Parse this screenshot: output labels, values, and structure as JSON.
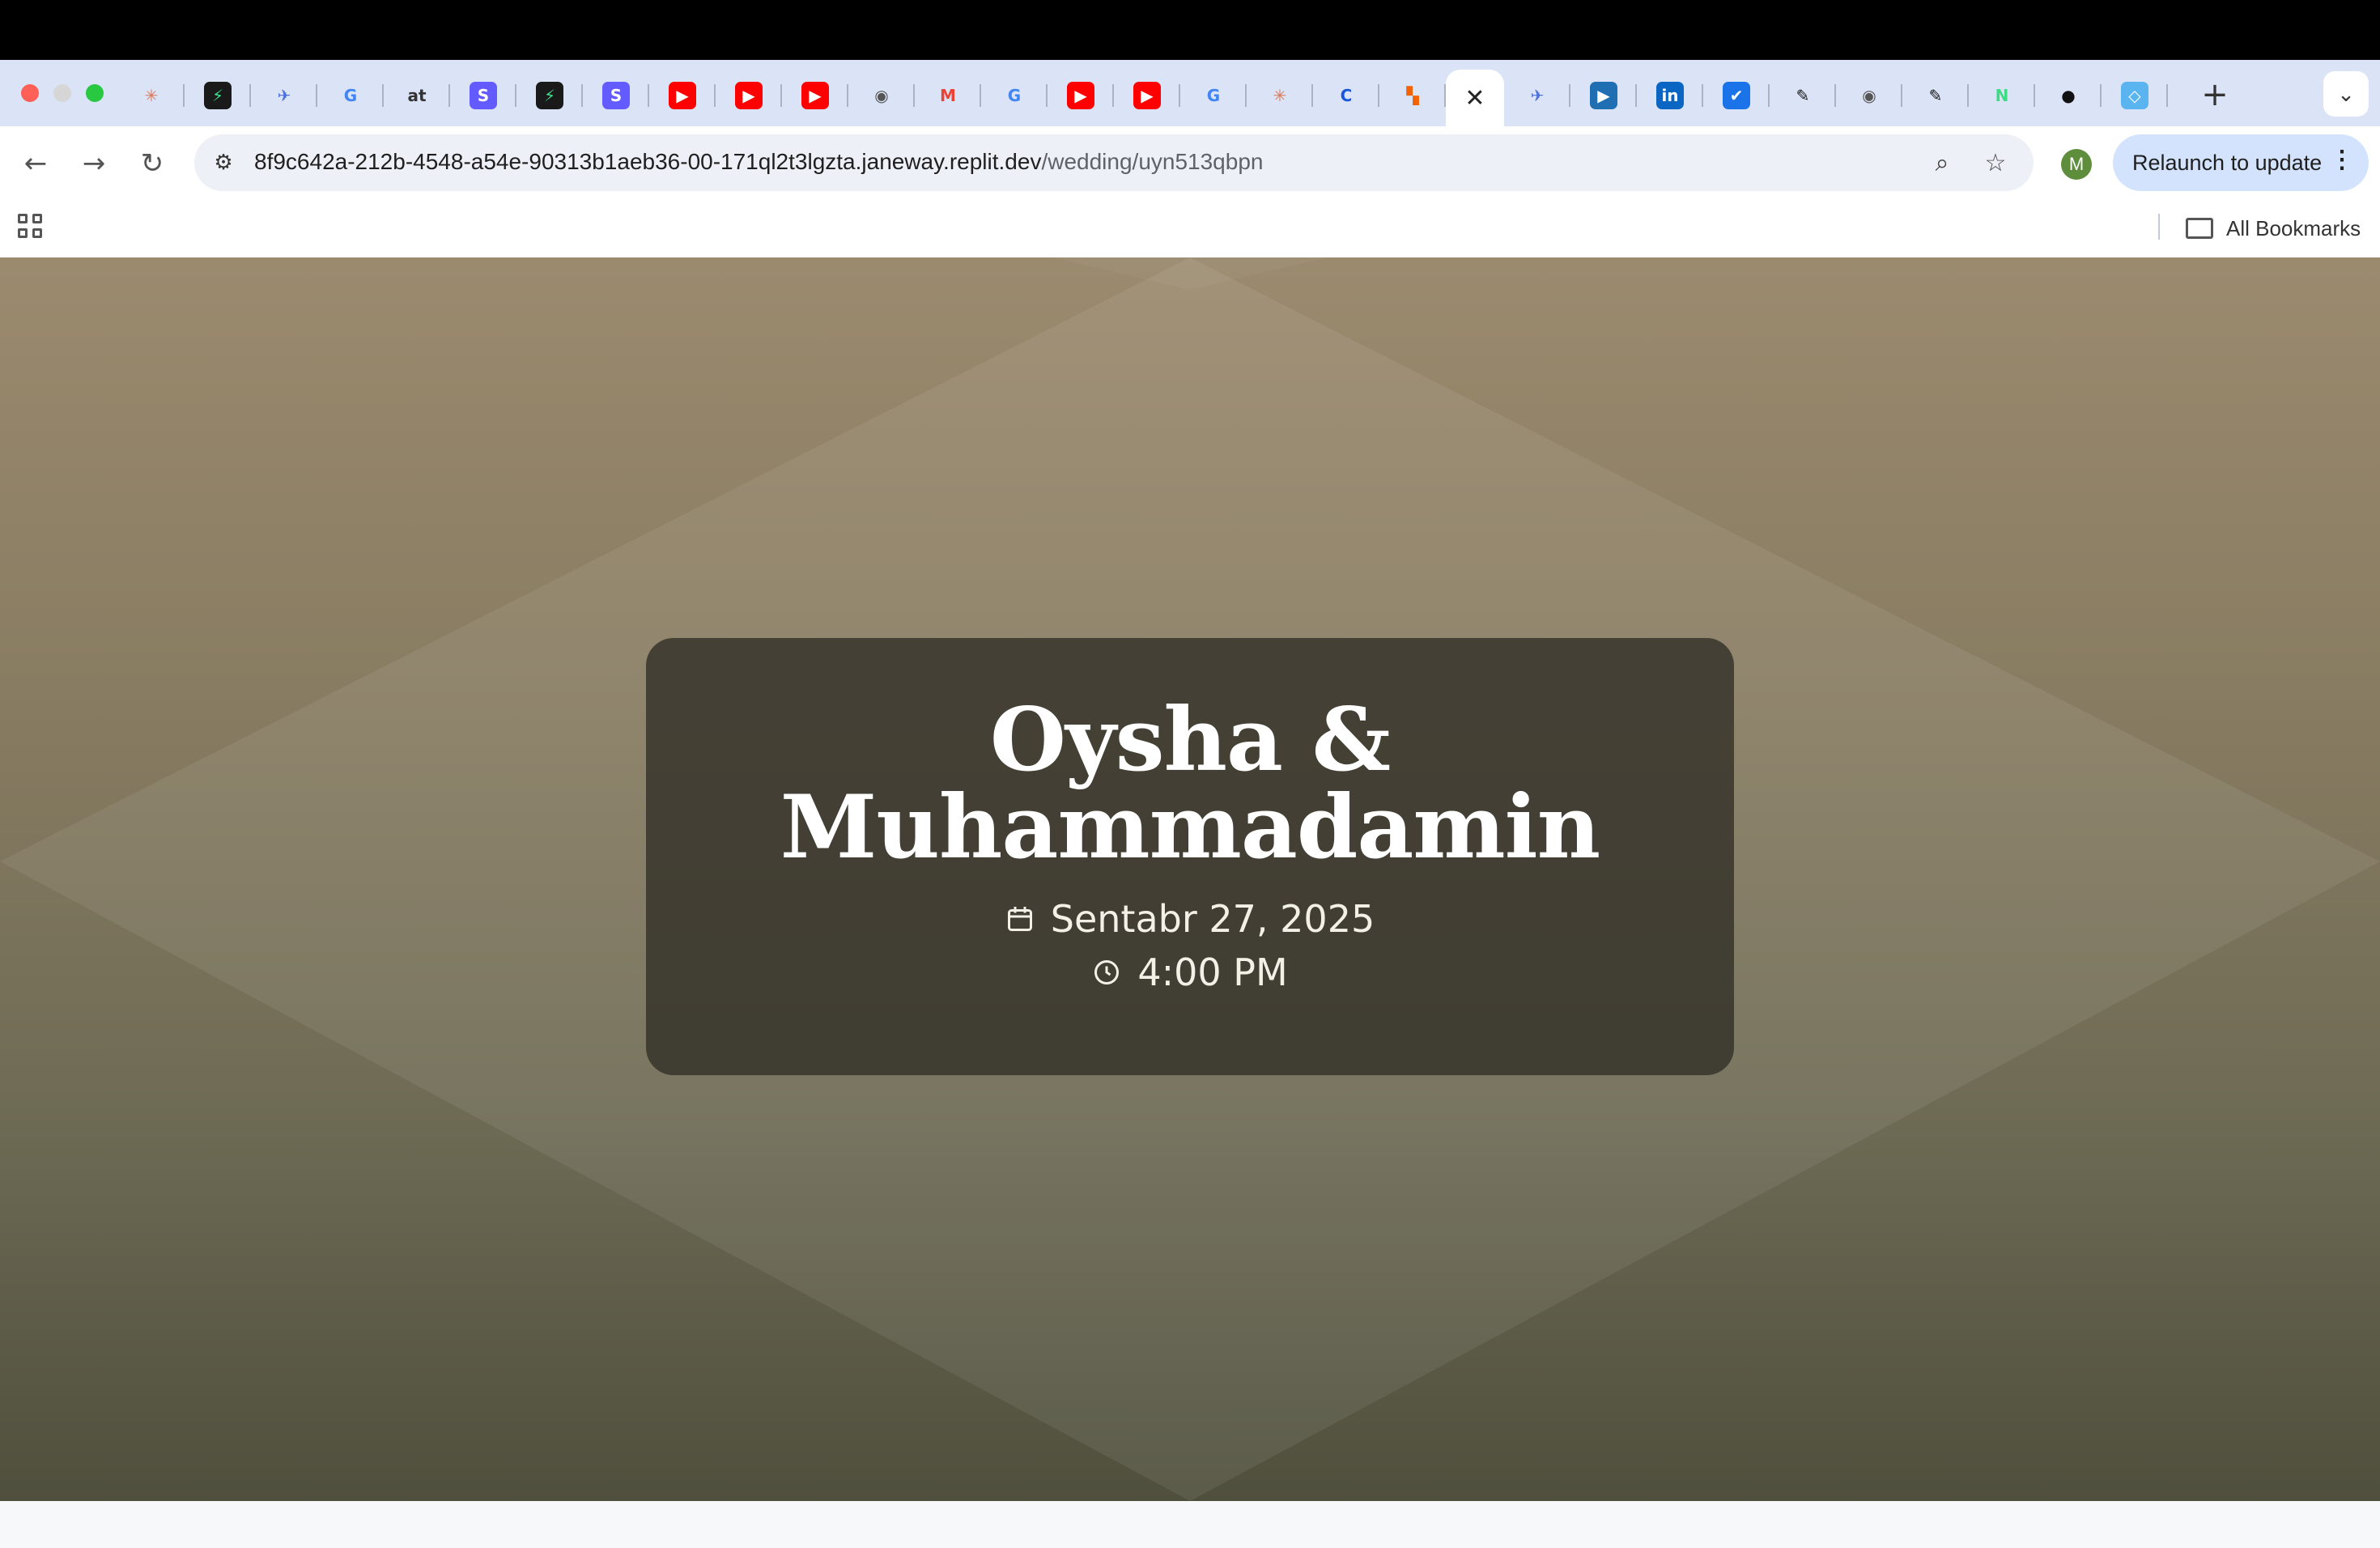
{
  "browser": {
    "tabs": [
      {
        "icon": "claude-icon",
        "glyph": "✳",
        "color": "#d97757",
        "bg": "transparent"
      },
      {
        "icon": "bolt-icon",
        "glyph": "⚡",
        "color": "#3ee08f",
        "bg": "#1a1a1a"
      },
      {
        "icon": "bird-icon",
        "glyph": "✈",
        "color": "#4a6ee0",
        "bg": "transparent"
      },
      {
        "icon": "google-icon",
        "glyph": "G",
        "color": "#4285f4",
        "bg": "transparent"
      },
      {
        "icon": "at-icon",
        "glyph": "at",
        "color": "#333333",
        "bg": "transparent"
      },
      {
        "icon": "stripe-icon",
        "glyph": "S",
        "color": "#ffffff",
        "bg": "#635bff"
      },
      {
        "icon": "bolt-icon",
        "glyph": "⚡",
        "color": "#3ee08f",
        "bg": "#1a1a1a"
      },
      {
        "icon": "stripe-icon",
        "glyph": "S",
        "color": "#ffffff",
        "bg": "#635bff"
      },
      {
        "icon": "youtube-icon",
        "glyph": "▶",
        "color": "#ffffff",
        "bg": "#ff0000"
      },
      {
        "icon": "youtube-icon",
        "glyph": "▶",
        "color": "#ffffff",
        "bg": "#ff0000"
      },
      {
        "icon": "youtube-icon",
        "glyph": "▶",
        "color": "#ffffff",
        "bg": "#ff0000"
      },
      {
        "icon": "globe-icon",
        "glyph": "◉",
        "color": "#555555",
        "bg": "transparent"
      },
      {
        "icon": "gmail-icon",
        "glyph": "M",
        "color": "#ea4335",
        "bg": "transparent"
      },
      {
        "icon": "google-icon",
        "glyph": "G",
        "color": "#4285f4",
        "bg": "transparent"
      },
      {
        "icon": "youtube-icon",
        "glyph": "▶",
        "color": "#ffffff",
        "bg": "#ff0000"
      },
      {
        "icon": "youtube-icon",
        "glyph": "▶",
        "color": "#ffffff",
        "bg": "#ff0000"
      },
      {
        "icon": "google-icon",
        "glyph": "G",
        "color": "#4285f4",
        "bg": "transparent"
      },
      {
        "icon": "claude-icon",
        "glyph": "✳",
        "color": "#d97757",
        "bg": "transparent"
      },
      {
        "icon": "c-icon",
        "glyph": "C",
        "color": "#1a56db",
        "bg": "transparent"
      },
      {
        "icon": "replit-icon",
        "glyph": "▚",
        "color": "#f26207",
        "bg": "transparent"
      },
      {
        "icon": "close-icon",
        "glyph": "✕",
        "color": "#222222",
        "bg": "transparent",
        "active": true
      },
      {
        "icon": "bird-icon",
        "glyph": "✈",
        "color": "#4a6ee0",
        "bg": "transparent"
      },
      {
        "icon": "video-icon",
        "glyph": "▶",
        "color": "#ffffff",
        "bg": "#1f6fb2"
      },
      {
        "icon": "linkedin-icon",
        "glyph": "in",
        "color": "#ffffff",
        "bg": "#0a66c2"
      },
      {
        "icon": "translate-icon",
        "glyph": "✔",
        "color": "#ffffff",
        "bg": "#1a73e8"
      },
      {
        "icon": "puzzle-icon",
        "glyph": "✎",
        "color": "#111111",
        "bg": "transparent"
      },
      {
        "icon": "globe-icon",
        "glyph": "◉",
        "color": "#555555",
        "bg": "transparent"
      },
      {
        "icon": "puzzle-icon",
        "glyph": "✎",
        "color": "#111111",
        "bg": "transparent"
      },
      {
        "icon": "notion-icon",
        "glyph": "N",
        "color": "#3ddc84",
        "bg": "transparent"
      },
      {
        "icon": "github-icon",
        "glyph": "●",
        "color": "#111111",
        "bg": "transparent"
      },
      {
        "icon": "diamond-icon",
        "glyph": "◇",
        "color": "#ffffff",
        "bg": "#5ab4f0"
      }
    ],
    "url_host": "8f9c642a-212b-4548-a54e-90313b1aeb36-00-171ql2t3lgzta.janeway.replit.dev",
    "url_path": "/wedding/uyn513qbpn",
    "avatar_letter": "M",
    "relaunch_label": "Relaunch to update",
    "bookmarks_label": "All Bookmarks"
  },
  "invitation": {
    "names_line1": "Oysha &",
    "names_line2": "Muhammadamin",
    "date": "Sentabr 27, 2025",
    "time": "4:00 PM"
  }
}
